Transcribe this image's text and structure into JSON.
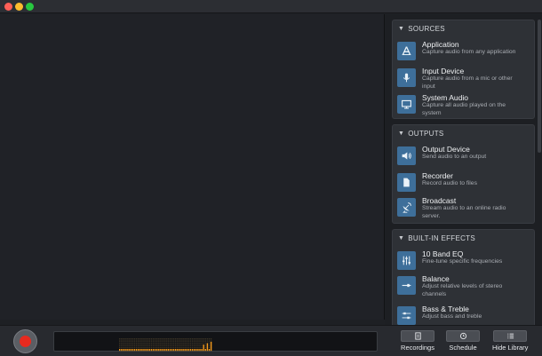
{
  "window": {
    "controls": [
      "close",
      "minimize",
      "maximize"
    ]
  },
  "library": {
    "sections": [
      {
        "title": "SOURCES",
        "items": [
          {
            "title": "Application",
            "desc": "Capture audio from any application",
            "icon": "application-icon"
          },
          {
            "title": "Input Device",
            "desc": "Capture audio from a mic or other input",
            "icon": "microphone-icon"
          },
          {
            "title": "System Audio",
            "desc": "Capture all audio played on the system",
            "icon": "monitor-icon"
          }
        ]
      },
      {
        "title": "OUTPUTS",
        "items": [
          {
            "title": "Output Device",
            "desc": "Send audio to an output",
            "icon": "speaker-icon"
          },
          {
            "title": "Recorder",
            "desc": "Record audio to files",
            "icon": "file-icon"
          },
          {
            "title": "Broadcast",
            "desc": "Stream audio to an online radio server.",
            "icon": "satellite-dish-icon"
          }
        ]
      },
      {
        "title": "BUILT-IN EFFECTS",
        "items": [
          {
            "title": "10 Band EQ",
            "desc": "Fine-tune specific frequencies",
            "icon": "equalizer-icon"
          },
          {
            "title": "Balance",
            "desc": "Adjust relative levels of stereo channels",
            "icon": "balance-icon"
          },
          {
            "title": "Bass & Treble",
            "desc": "Adjust bass and treble",
            "icon": "sliders-icon"
          }
        ]
      }
    ]
  },
  "bottombar": {
    "record": {
      "icon": "record-icon"
    },
    "tools": [
      {
        "label": "Recordings",
        "icon": "recordings-icon"
      },
      {
        "label": "Schedule",
        "icon": "clock-icon"
      },
      {
        "label": "Hide Library",
        "icon": "list-icon"
      }
    ]
  },
  "colors": {
    "accent_icon": "#3e6f9a",
    "record_red": "#e82a1f",
    "meter_amber": "#f59a1b"
  }
}
